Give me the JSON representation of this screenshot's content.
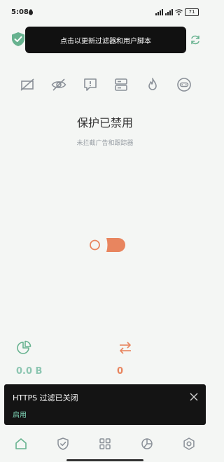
{
  "status_bar": {
    "time": "5:08",
    "battery": "71"
  },
  "tooltip": {
    "text": "点击以更新过滤器和用户脚本"
  },
  "protection": {
    "title": "保护已禁用",
    "subtitle": "未拦截广告和跟踪器"
  },
  "stats": {
    "traffic_value": "0.0 B",
    "requests_value": "0"
  },
  "snackbar": {
    "message": "HTTPS 过滤已关闭",
    "action": "启用"
  },
  "icons": {
    "top_left": "shield-check-icon",
    "refresh": "refresh-icon",
    "features": [
      "ad-block-icon",
      "eye-off-icon",
      "message-alert-icon",
      "server-icon",
      "flame-icon",
      "gamepad-icon"
    ],
    "stats": [
      "pie-chart-icon",
      "swap-arrows-icon"
    ],
    "nav": [
      "home-icon",
      "shield-icon",
      "apps-icon",
      "stats-icon",
      "settings-icon"
    ]
  },
  "colors": {
    "accent_green": "#67b28f",
    "accent_orange": "#e8855f",
    "snack_action": "#7ed3b6",
    "icon_gray": "#8a9098"
  }
}
